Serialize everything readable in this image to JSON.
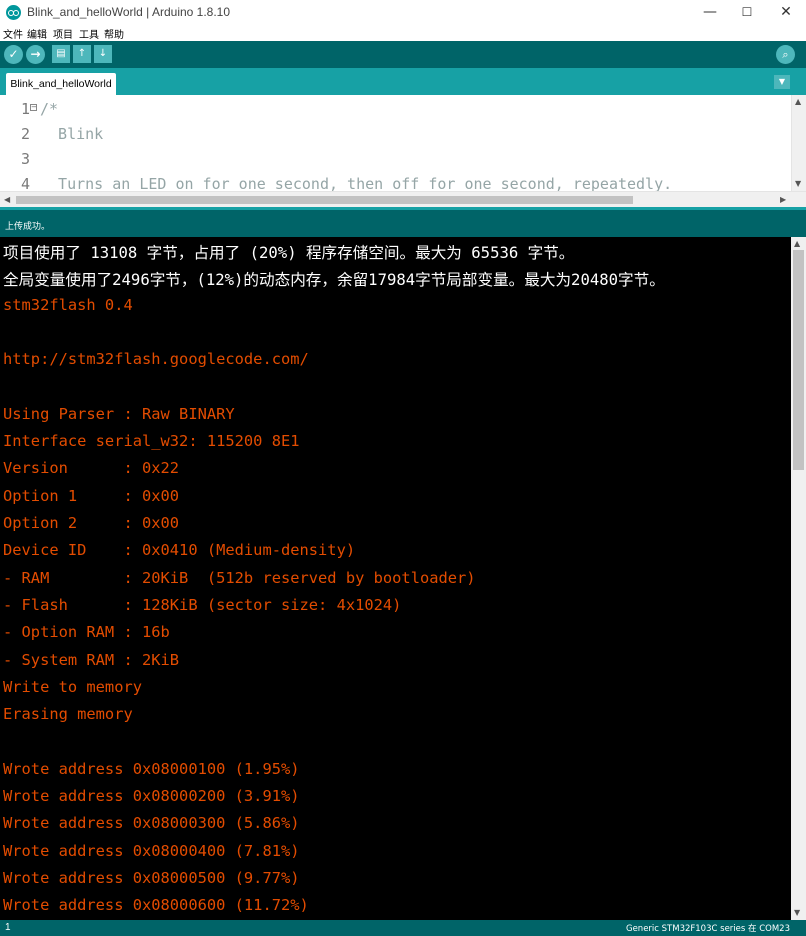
{
  "window": {
    "title": "Blink_and_helloWorld | Arduino 1.8.10",
    "minimize_glyph": "—",
    "maximize_glyph": "☐",
    "close_glyph": "✕"
  },
  "menu": [
    "文件",
    "编辑",
    "项目",
    "工具",
    "帮助"
  ],
  "toolbar": {
    "verify_icon": "✓",
    "upload_icon": "→",
    "new_icon": "▤",
    "open_icon": "↑",
    "save_icon": "↓",
    "serial_monitor_icon": "⌕"
  },
  "tabs": [
    {
      "label": "Blink_and_helloWorld",
      "active": true
    }
  ],
  "tab_menu_icon": "▼",
  "editor": {
    "lines": [
      {
        "num": "1",
        "text": "/*"
      },
      {
        "num": "2",
        "text": "  Blink"
      },
      {
        "num": "3",
        "text": ""
      },
      {
        "num": "4",
        "text": "  Turns an LED on for one second, then off for one second, repeatedly."
      }
    ],
    "fold_marker": "⊟"
  },
  "status": {
    "message": "上传成功。"
  },
  "console": {
    "lines": [
      {
        "text": "项目使用了 13108 字节，占用了 (20%) 程序存储空间。最大为 65536 字节。",
        "color": "white"
      },
      {
        "text": "全局变量使用了2496字节，(12%)的动态内存，余留17984字节局部变量。最大为20480字节。",
        "color": "white"
      },
      {
        "text": "stm32flash 0.4",
        "color": "orange"
      },
      {
        "text": "",
        "color": "orange"
      },
      {
        "text": "http://stm32flash.googlecode.com/",
        "color": "orange"
      },
      {
        "text": "",
        "color": "orange"
      },
      {
        "text": "Using Parser : Raw BINARY",
        "color": "orange"
      },
      {
        "text": "Interface serial_w32: 115200 8E1",
        "color": "orange"
      },
      {
        "text": "Version      : 0x22",
        "color": "orange"
      },
      {
        "text": "Option 1     : 0x00",
        "color": "orange"
      },
      {
        "text": "Option 2     : 0x00",
        "color": "orange"
      },
      {
        "text": "Device ID    : 0x0410 (Medium-density)",
        "color": "orange"
      },
      {
        "text": "- RAM        : 20KiB  (512b reserved by bootloader)",
        "color": "orange"
      },
      {
        "text": "- Flash      : 128KiB (sector size: 4x1024)",
        "color": "orange"
      },
      {
        "text": "- Option RAM : 16b",
        "color": "orange"
      },
      {
        "text": "- System RAM : 2KiB",
        "color": "orange"
      },
      {
        "text": "Write to memory",
        "color": "orange"
      },
      {
        "text": "Erasing memory",
        "color": "orange"
      },
      {
        "text": "",
        "color": "orange"
      },
      {
        "text": "Wrote address 0x08000100 (1.95%)",
        "color": "orange"
      },
      {
        "text": "Wrote address 0x08000200 (3.91%)",
        "color": "orange"
      },
      {
        "text": "Wrote address 0x08000300 (5.86%)",
        "color": "orange"
      },
      {
        "text": "Wrote address 0x08000400 (7.81%)",
        "color": "orange"
      },
      {
        "text": "Wrote address 0x08000500 (9.77%)",
        "color": "orange"
      },
      {
        "text": "Wrote address 0x08000600 (11.72%)",
        "color": "orange"
      }
    ]
  },
  "bottom": {
    "line_number": "1",
    "board": "Generic STM32F103C series 在 COM23"
  },
  "colors": {
    "teal_dark": "#006468",
    "teal_mid": "#17a1a5",
    "button_bg": "#4db7bb",
    "console_white": "#ffffff",
    "console_orange": "#e34c00"
  }
}
